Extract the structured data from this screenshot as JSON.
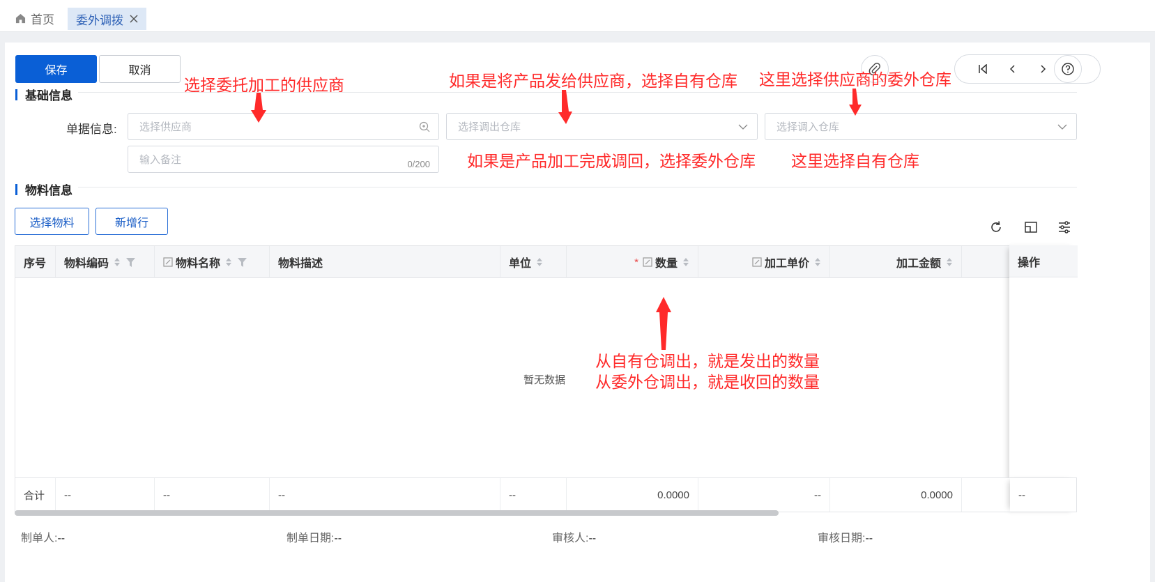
{
  "tabs": {
    "home_label": "首页",
    "active_label": "委外调拨"
  },
  "toolbar": {
    "save_label": "保存",
    "cancel_label": "取消"
  },
  "basic_section": {
    "title": "基础信息",
    "doc_label": "单据信息:",
    "supplier_placeholder": "选择供应商",
    "out_warehouse_placeholder": "选择调出仓库",
    "in_warehouse_placeholder": "选择调入仓库",
    "remark_placeholder": "输入备注",
    "remark_counter": "0/200"
  },
  "material_section": {
    "title": "物料信息",
    "select_material_label": "选择物料",
    "add_row_label": "新增行"
  },
  "table": {
    "columns": {
      "seq": "序号",
      "code": "物料编码",
      "name": "物料名称",
      "desc": "物料描述",
      "unit": "单位",
      "qty": "数量",
      "price": "加工单价",
      "amount": "加工金额",
      "op": "操作"
    },
    "required_mark": "*",
    "empty_text": "暂无数据",
    "total": {
      "label": "合计",
      "code": "--",
      "name": "--",
      "desc": "--",
      "unit": "--",
      "qty": "0.0000",
      "price": "--",
      "amount": "0.0000",
      "op": "--"
    }
  },
  "footer": {
    "creator_label": "制单人:",
    "creator_value": "--",
    "create_date_label": "制单日期:",
    "create_date_value": "--",
    "reviewer_label": "审核人:",
    "reviewer_value": "--",
    "review_date_label": "审核日期:",
    "review_date_value": "--"
  },
  "annotations": {
    "supplier_note": "选择委托加工的供应商",
    "out_note_1": "如果是将产品发给供应商，选择自有仓库",
    "out_note_2": "如果是产品加工完成调回，选择委外仓库",
    "in_note_1": "这里选择供应商的委外仓库",
    "in_note_2": "这里选择自有仓库",
    "qty_note_1": "从自有仓调出，就是发出的数量",
    "qty_note_2": "从委外仓调出，就是收回的数量"
  },
  "colors": {
    "primary": "#0a5fd6",
    "annotation": "#ff2a2a",
    "required": "#e94848"
  },
  "icons": [
    "home-icon",
    "close-icon",
    "paperclip-icon",
    "first-page-icon",
    "prev-icon",
    "next-icon",
    "last-page-icon",
    "help-icon",
    "search-plus-icon",
    "chevron-down-icon",
    "refresh-icon",
    "column-resize-icon",
    "settings-sliders-icon",
    "sort-icon",
    "filter-icon",
    "edit-icon"
  ]
}
